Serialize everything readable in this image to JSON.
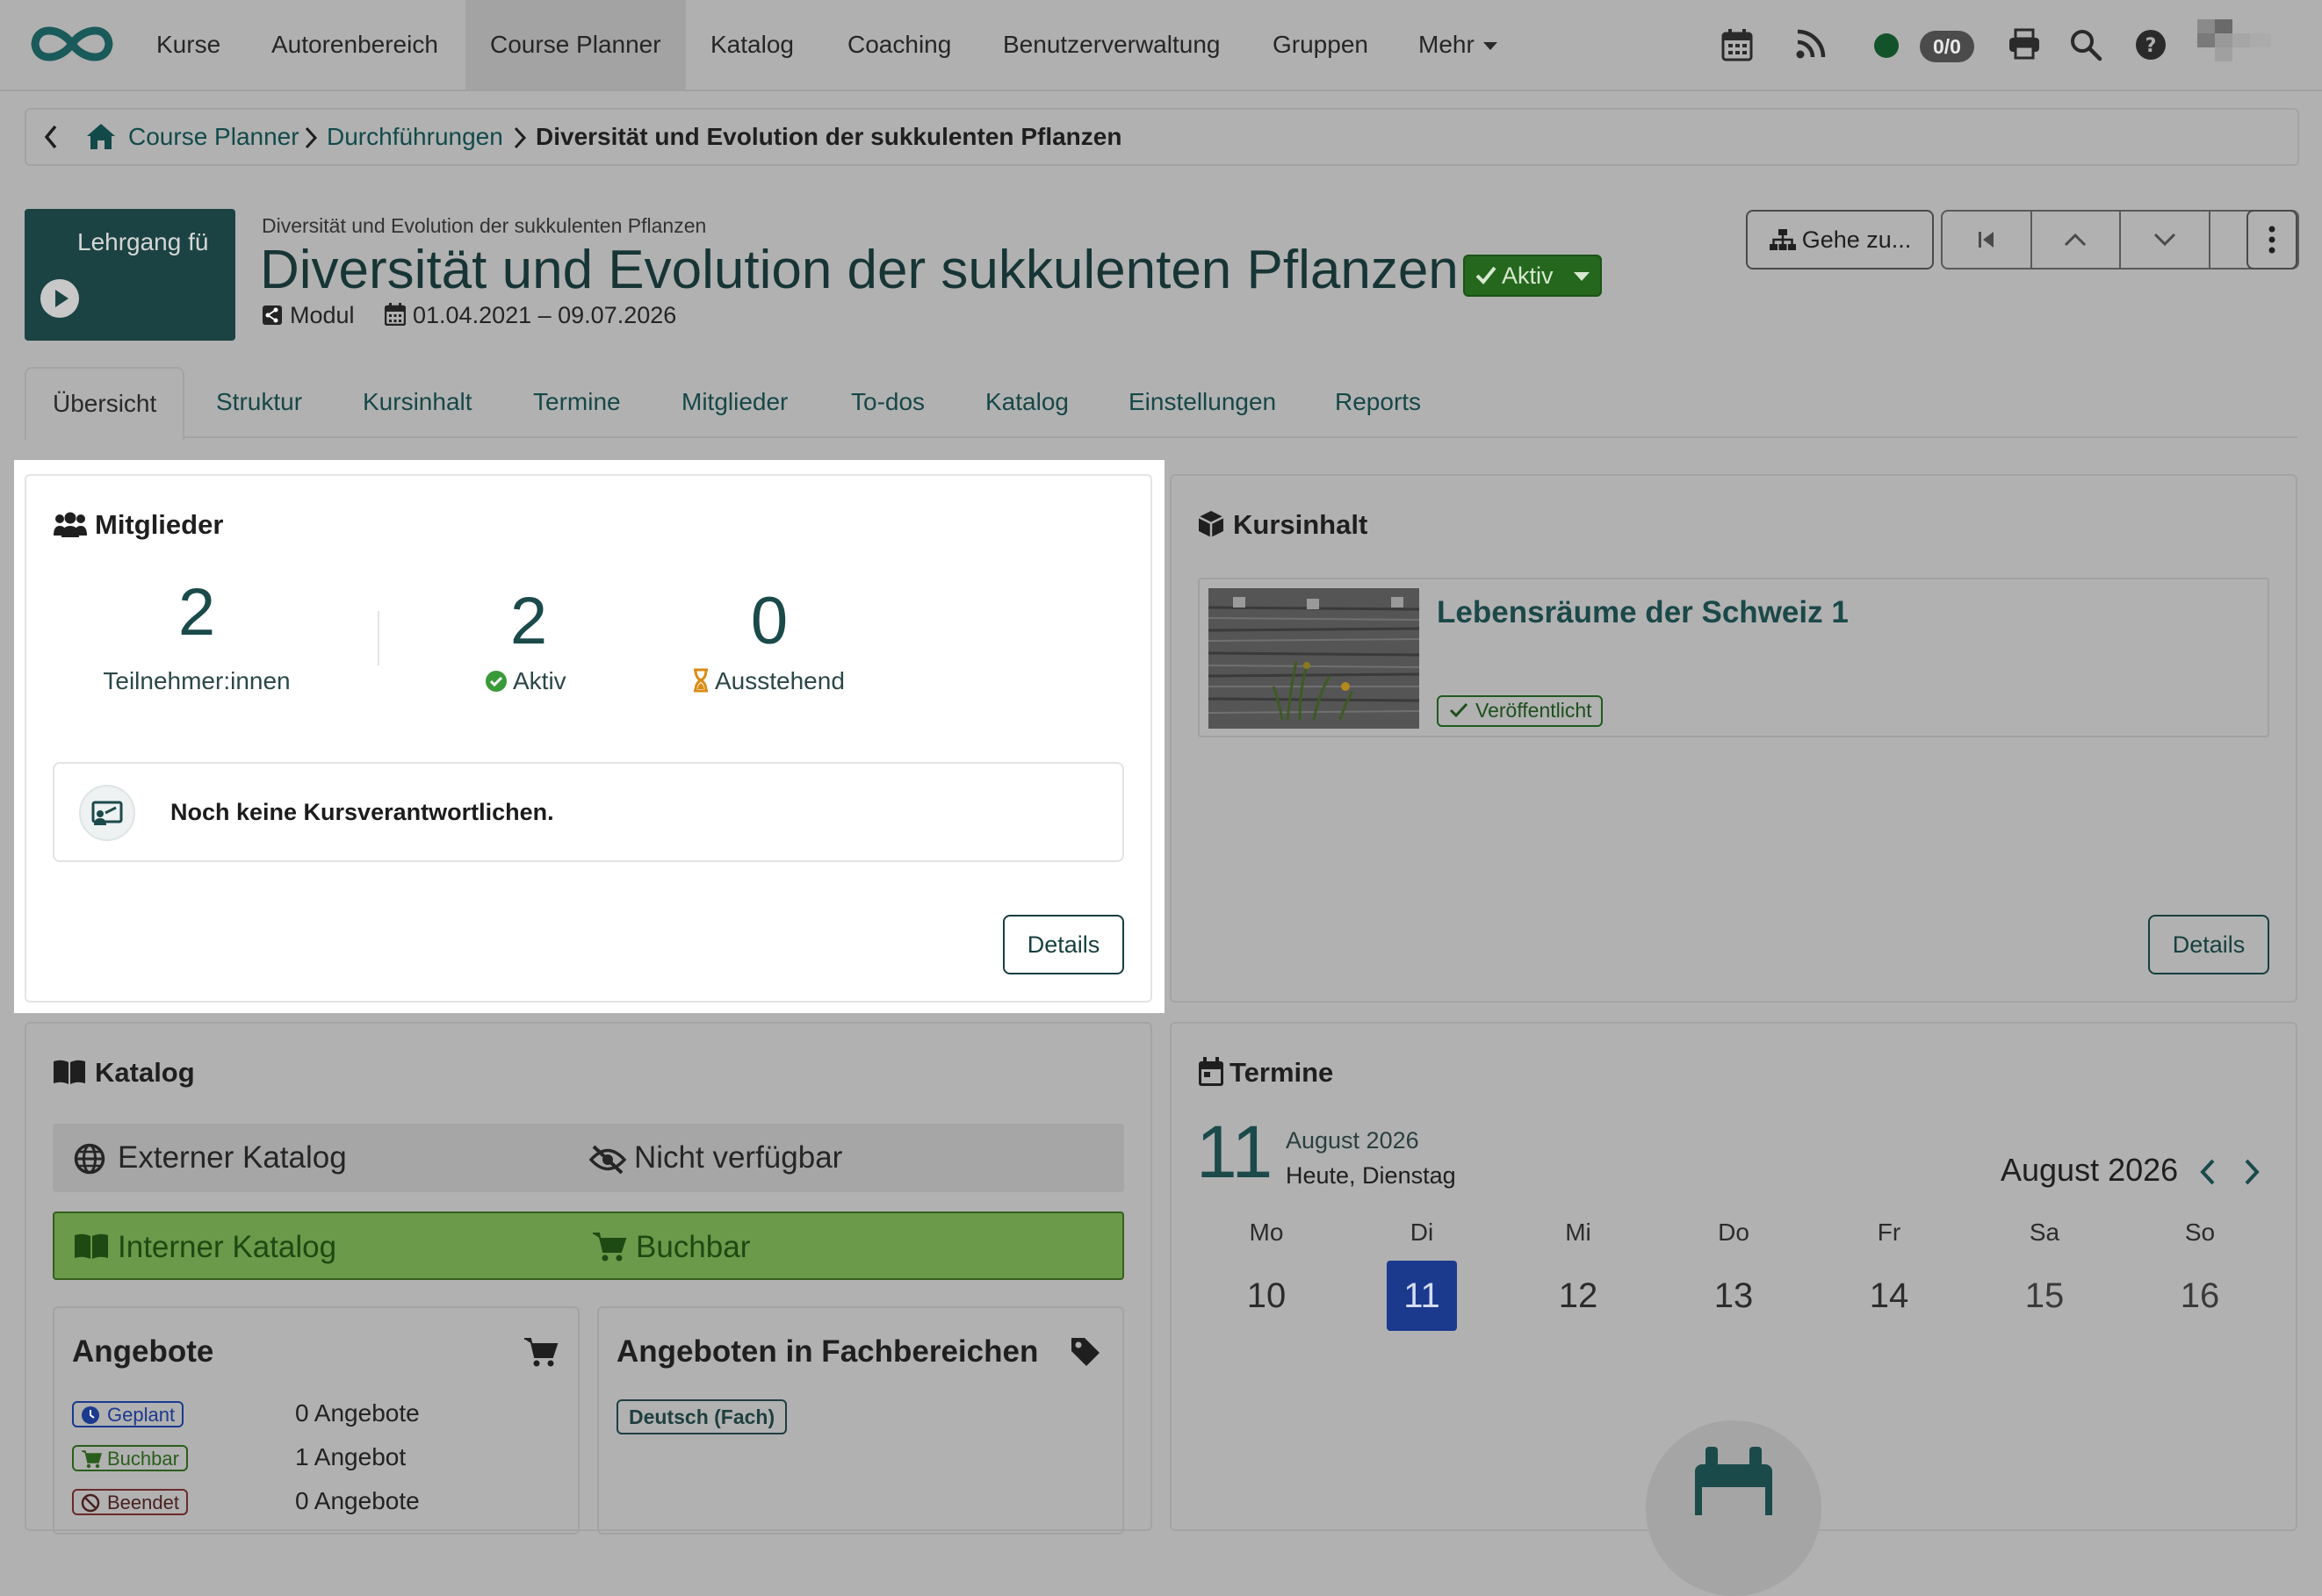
{
  "nav": {
    "items": [
      "Kurse",
      "Autorenbereich",
      "Course Planner",
      "Katalog",
      "Coaching",
      "Benutzerverwaltung",
      "Gruppen",
      "Mehr"
    ],
    "active": "Course Planner",
    "counter": "0/0",
    "icons": [
      "calendar-icon",
      "rss-icon",
      "status-dot-icon",
      "print-icon",
      "search-icon",
      "help-icon"
    ]
  },
  "breadcrumb": {
    "items": [
      "Course Planner",
      "Durchführungen"
    ],
    "current": "Diversität und Evolution der sukkulenten Pflanzen"
  },
  "header": {
    "thumb_text": "Lehrgang fü",
    "supertitle": "Diversität und Evolution der sukkulenten Pflanzen",
    "title": "Diversität und Evolution der sukkulenten Pflanzen",
    "status": "Aktiv",
    "type": "Modul",
    "dates": "01.04.2021 – 09.07.2026",
    "goto_label": "Gehe zu..."
  },
  "tabs": [
    "Übersicht",
    "Struktur",
    "Kursinhalt",
    "Termine",
    "Mitglieder",
    "To-dos",
    "Katalog",
    "Einstellungen",
    "Reports"
  ],
  "members": {
    "title": "Mitglieder",
    "participants_count": "2",
    "participants_label": "Teilnehmer:innen",
    "active_count": "2",
    "active_label": "Aktiv",
    "pending_count": "0",
    "pending_label": "Ausstehend",
    "notice": "Noch keine Kursverantwortlichen.",
    "details": "Details"
  },
  "content": {
    "title": "Kursinhalt",
    "course_title": "Lebensräume der Schweiz 1",
    "badge": "Veröffentlicht",
    "details": "Details"
  },
  "catalog": {
    "title": "Katalog",
    "external_label": "Externer Katalog",
    "external_status": "Nicht verfügbar",
    "internal_label": "Interner Katalog",
    "internal_status": "Buchbar",
    "offers_title": "Angebote",
    "offers": [
      {
        "status": "Geplant",
        "value": "0 Angebote"
      },
      {
        "status": "Buchbar",
        "value": "1 Angebot"
      },
      {
        "status": "Beendet",
        "value": "0 Angebote"
      }
    ],
    "fields_title": "Angeboten in Fachbereichen",
    "fields_badge": "Deutsch (Fach)"
  },
  "dates": {
    "title": "Termine",
    "day": "11",
    "month_year": "August 2026",
    "today_label": "Heute, Dienstag",
    "nav_label": "August 2026",
    "weekdays": [
      "Mo",
      "Di",
      "Mi",
      "Do",
      "Fr",
      "Sa",
      "So"
    ],
    "days": [
      "10",
      "11",
      "12",
      "13",
      "14",
      "15",
      "16"
    ],
    "today_index": 1
  },
  "colors": {
    "brand": "#1b4a4a",
    "active_green": "#24671d",
    "today_blue": "#1b3a8e",
    "overlay_gray": "#b1b1b1"
  }
}
